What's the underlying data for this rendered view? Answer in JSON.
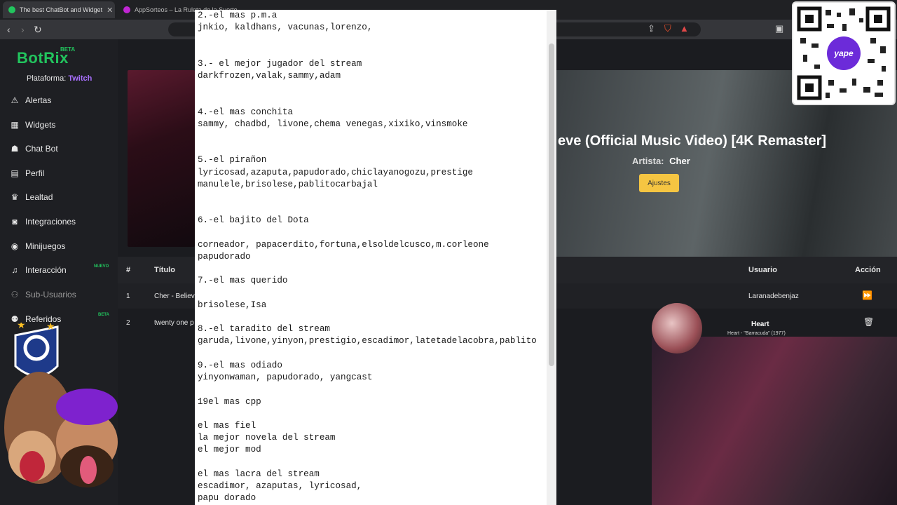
{
  "browser": {
    "tabs": [
      {
        "title": "The best ChatBot and Widget",
        "close": "✕",
        "active": true
      },
      {
        "title": "AppSorteos – La Ruleta de la Suerte",
        "active": false
      }
    ]
  },
  "sidebar": {
    "logo": "BotRix",
    "logo_badge": "BETA",
    "platform_label": "Plataforma:",
    "platform_value": "Twitch",
    "items": [
      {
        "label": "Alertas",
        "icon": "warning-icon"
      },
      {
        "label": "Widgets",
        "icon": "grid-icon"
      },
      {
        "label": "Chat Bot",
        "icon": "robot-icon"
      },
      {
        "label": "Perfil",
        "icon": "id-card-icon"
      },
      {
        "label": "Lealtad",
        "icon": "trophy-icon"
      },
      {
        "label": "Integraciones",
        "icon": "plug-icon"
      },
      {
        "label": "Minijuegos",
        "icon": "gamepad-icon"
      },
      {
        "label": "Interacción",
        "icon": "music-icon",
        "badge": "NUEVO"
      },
      {
        "label": "Sub-Usuarios",
        "icon": "users-icon"
      },
      {
        "label": "Referidos",
        "icon": "user-group-icon",
        "badge": "BETA"
      }
    ]
  },
  "player": {
    "title": "eve (Official Music Video) [4K Remaster]",
    "artist_label": "Artista:",
    "artist_value": "Cher",
    "settings_button": "Ajustes"
  },
  "queue": {
    "headers": {
      "num": "#",
      "title": "Título",
      "user": "Usuario",
      "action": "Acción"
    },
    "rows": [
      {
        "num": "1",
        "title": "Cher - Believ",
        "user": "Laranadebenjaz",
        "action_icon": "fast-forward-icon"
      },
      {
        "num": "2",
        "title": "twenty one p",
        "user": "",
        "action_icon": "trash-icon"
      }
    ]
  },
  "notepad": {
    "lines": [
      "2.-el mas p.m.a",
      "jnkio, kaldhans, vacunas,lorenzo,",
      "",
      "",
      "3.- el mejor jugador del stream",
      "darkfrozen,valak,sammy,adam",
      "",
      "",
      "4.-el mas conchita",
      "sammy, chadbd, livone,chema venegas,xixiko,vinsmoke",
      "",
      "",
      "5.-el pirañon",
      "lyricosad,azaputa,papudorado,chiclayanogozu,prestige",
      "manulele,brisolese,pablitocarbajal",
      "",
      "",
      "6.-el bajito del Dota",
      "",
      "corneador, papacerdito,fortuna,elsoldelcusco,m.corleone",
      "papudorado",
      "",
      "7.-el mas querido",
      "",
      "brisolese,Isa",
      "",
      "8.-el taradito del stream",
      "garuda,livone,yinyon,prestigio,escadimor,latetadelacobra,pablito",
      "",
      "9.-el mas odiado",
      "yinyonwaman, papudorado, yangcast",
      "",
      "19el mas cpp",
      "",
      "el mas fiel",
      "la mejor novela del stream",
      "el mejor mod",
      "",
      "el mas lacra del stream",
      "escadimor, azaputas, lyricosad,",
      "papu dorado"
    ]
  },
  "now_playing_overlay": {
    "title": "Heart",
    "subtitle": "Heart - \"Barracuda\" (1977)"
  },
  "qr_overlay": {
    "brand": "yape"
  },
  "colors": {
    "brand_green": "#22c55e",
    "twitch_purple": "#a970ff",
    "settings_yellow": "#f5c542",
    "yape_purple": "#6c2bd9"
  }
}
